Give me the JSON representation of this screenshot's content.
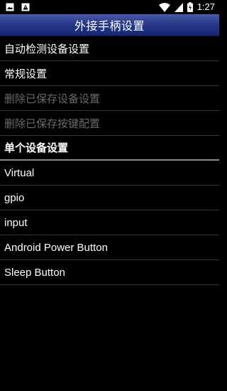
{
  "status_bar": {
    "left_icons": [
      "image-icon",
      "warning-icon"
    ],
    "right_icons": [
      "wifi-icon",
      "signal-icon",
      "battery-charging-icon"
    ],
    "time": "1:27"
  },
  "title_bar": {
    "title": "外接手柄设置"
  },
  "menu": {
    "items": [
      {
        "label": "自动检测设备设置",
        "enabled": true
      },
      {
        "label": "常规设置",
        "enabled": true
      },
      {
        "label": "删除已保存设备设置",
        "enabled": false
      },
      {
        "label": "删除已保存按键配置",
        "enabled": false
      }
    ],
    "category_label": "单个设备设置",
    "devices": [
      {
        "label": "Virtual"
      },
      {
        "label": "gpio"
      },
      {
        "label": "input"
      },
      {
        "label": "Android Power Button"
      },
      {
        "label": "Sleep Button"
      }
    ]
  },
  "colors": {
    "background": "#000000",
    "title_bar": "#283a8a",
    "text": "#ffffff",
    "disabled_text": "#6a6a6a",
    "divider": "#333333"
  }
}
